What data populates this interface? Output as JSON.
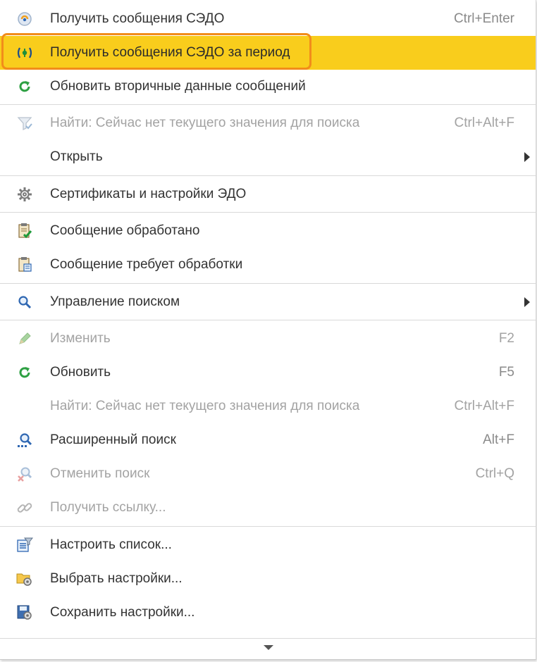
{
  "menu": {
    "items": [
      {
        "label": "Получить сообщения СЭДО",
        "shortcut": "Ctrl+Enter",
        "icon": "receive-messages-icon"
      },
      {
        "label": "Получить сообщения СЭДО за период",
        "shortcut": "",
        "icon": "receive-period-icon",
        "state": "highlighted"
      },
      {
        "label": "Обновить вторичные данные сообщений",
        "shortcut": "",
        "icon": "refresh-icon"
      },
      {
        "label": "Найти: Сейчас нет текущего значения для поиска",
        "shortcut": "Ctrl+Alt+F",
        "icon": "filter-icon",
        "state": "disabled"
      },
      {
        "label": "Открыть",
        "shortcut": "",
        "icon": "",
        "submenu": true
      },
      {
        "label": "Сертификаты и настройки ЭДО",
        "shortcut": "",
        "icon": "gear-icon"
      },
      {
        "label": "Сообщение обработано",
        "shortcut": "",
        "icon": "clipboard-check-icon"
      },
      {
        "label": "Сообщение требует обработки",
        "shortcut": "",
        "icon": "clipboard-list-icon"
      },
      {
        "label": "Управление поиском",
        "shortcut": "",
        "icon": "search-icon",
        "submenu": true
      },
      {
        "label": "Изменить",
        "shortcut": "F2",
        "icon": "pencil-icon",
        "state": "disabled"
      },
      {
        "label": "Обновить",
        "shortcut": "F5",
        "icon": "refresh-icon"
      },
      {
        "label": "Найти: Сейчас нет текущего значения для поиска",
        "shortcut": "Ctrl+Alt+F",
        "icon": "",
        "state": "disabled"
      },
      {
        "label": "Расширенный поиск",
        "shortcut": "Alt+F",
        "icon": "advanced-search-icon"
      },
      {
        "label": "Отменить поиск",
        "shortcut": "Ctrl+Q",
        "icon": "cancel-search-icon",
        "state": "disabled"
      },
      {
        "label": "Получить ссылку...",
        "shortcut": "",
        "icon": "link-icon",
        "state": "disabled"
      },
      {
        "label": "Настроить список...",
        "shortcut": "",
        "icon": "list-settings-icon"
      },
      {
        "label": "Выбрать настройки...",
        "shortcut": "",
        "icon": "folder-settings-icon"
      },
      {
        "label": "Сохранить настройки...",
        "shortcut": "",
        "icon": "save-settings-icon"
      }
    ]
  },
  "colors": {
    "highlight": "#f9cd1c",
    "focus_ring": "#f28c1a",
    "text": "#333333",
    "disabled_text": "#a3a3a3",
    "shortcut_text": "#8a8a8a",
    "separator": "#d9d9d9"
  }
}
